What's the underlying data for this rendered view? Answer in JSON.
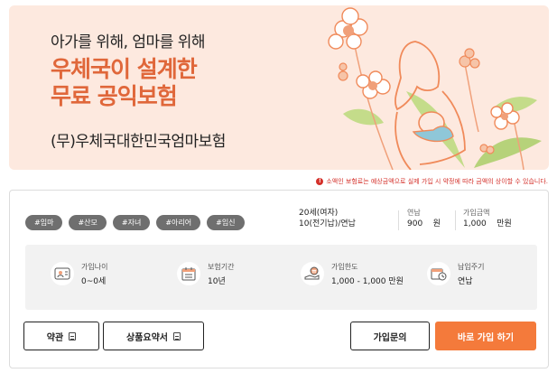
{
  "banner": {
    "subtitle": "아가를 위해, 엄마를 위해",
    "title_line1": "우체국이 설계한",
    "title_line2": "무료 공익보험",
    "product_name": "(무)우체국대한민국엄마보험"
  },
  "notice": {
    "icon": "exclamation-icon",
    "text": "소액인 보험료는 예상금액으로 실제 가입 시 약정에 따라 금액의 상이할 수 있습니다."
  },
  "tags": [
    "#임마",
    "#산모",
    "#자녀",
    "#아리어",
    "#임신"
  ],
  "summary": {
    "age_gender": "20세(여자)",
    "term": "10(전기납)/연납",
    "premium_label": "연납",
    "premium_value": "900",
    "premium_unit": "원",
    "amount_label": "가입금액",
    "amount_value": "1,000",
    "amount_unit": "만원"
  },
  "details": [
    {
      "icon": "person-card-icon",
      "label": "가입나이",
      "value": "0~0세"
    },
    {
      "icon": "calendar-icon",
      "label": "보험기간",
      "value": "10년"
    },
    {
      "icon": "won-hand-icon",
      "label": "가입한도",
      "value": "1,000 - 1,000 만원"
    },
    {
      "icon": "calendar-clock-icon",
      "label": "납입주기",
      "value": "연납"
    }
  ],
  "buttons": {
    "terms": "약관",
    "product_summary": "상품요약서",
    "inquiry": "가입문의",
    "join_now": "바로 가입 하기"
  },
  "colors": {
    "banner_bg": "#fde9df",
    "accent": "#e0673a",
    "primary_button": "#f47a3b",
    "tag_bg": "#6f6f6f",
    "notice": "#d4302a"
  }
}
